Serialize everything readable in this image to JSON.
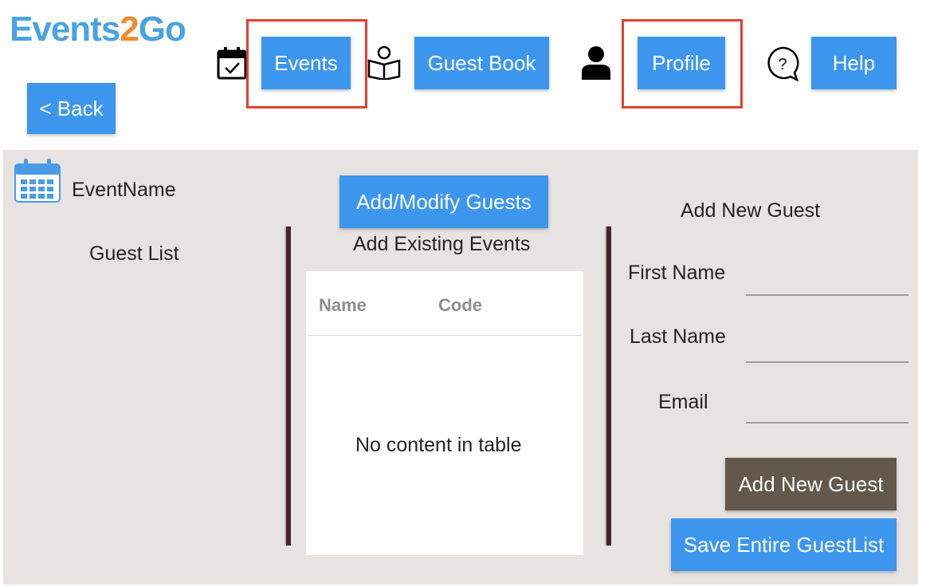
{
  "app": {
    "logo_part1": "Events",
    "logo_part2": "2",
    "logo_part3": "Go"
  },
  "nav": {
    "back_label": "< Back",
    "events_label": "Events",
    "guestbook_label": "Guest Book",
    "profile_label": "Profile",
    "help_label": "Help"
  },
  "event": {
    "name": "EventName"
  },
  "left": {
    "guest_list_title": "Guest List"
  },
  "middle": {
    "add_modify_label": "Add/Modify Guests",
    "add_existing_title": "Add Existing Events",
    "table": {
      "columns": [
        "Name",
        "Code"
      ],
      "empty_message": "No content in table"
    }
  },
  "right": {
    "title": "Add New Guest",
    "first_name_label": "First Name",
    "last_name_label": "Last Name",
    "email_label": "Email",
    "first_name_value": "",
    "last_name_value": "",
    "email_value": "",
    "add_new_guest_label": "Add New Guest",
    "save_list_label": "Save Entire GuestList"
  },
  "colors": {
    "primary": "#3d96ee",
    "secondary_button": "#63584b",
    "highlight": "#e0402f",
    "panel": "#e7e3e1",
    "logo_blue": "#4aa3df",
    "logo_orange": "#f08a2c"
  }
}
